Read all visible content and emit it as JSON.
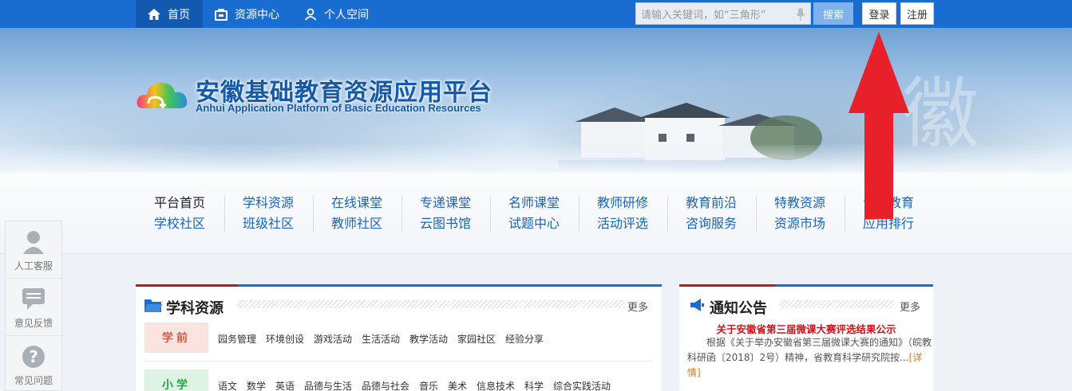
{
  "topnav": {
    "items": [
      {
        "label": "首页",
        "icon": "home-icon"
      },
      {
        "label": "资源中心",
        "icon": "resource-center-icon"
      },
      {
        "label": "个人空间",
        "icon": "user-icon"
      }
    ],
    "search_placeholder": "请输入关键词，如“三角形”",
    "search_label": "搜索",
    "login_label": "登录",
    "register_label": "注册"
  },
  "banner": {
    "title": "安徽基础教育资源应用平台",
    "subtitle": "Anhui Application Platform of Basic Education Resources",
    "calligraphy": "徽"
  },
  "catnav": {
    "columns": [
      [
        "平台首页",
        "学校社区"
      ],
      [
        "学科资源",
        "班级社区"
      ],
      [
        "在线课堂",
        "教师社区"
      ],
      [
        "专递课堂",
        "云图书馆"
      ],
      [
        "名师课堂",
        "试题中心"
      ],
      [
        "教师研修",
        "活动评选"
      ],
      [
        "教育前沿",
        "咨询服务"
      ],
      [
        "特教资源",
        "资源市场"
      ],
      [
        "专题教育",
        "应用排行"
      ]
    ]
  },
  "sidefloat": {
    "items": [
      {
        "label": "人工客服",
        "icon": "customer-service-icon"
      },
      {
        "label": "意见反馈",
        "icon": "feedback-icon"
      },
      {
        "label": "常见问题",
        "icon": "question-icon"
      }
    ]
  },
  "subject_panel": {
    "title": "学科资源",
    "more": "更多",
    "grades": [
      {
        "label": "学前",
        "subjects": [
          "园务管理",
          "环境创设",
          "游戏活动",
          "生活活动",
          "教学活动",
          "家园社区",
          "经验分享"
        ]
      },
      {
        "label": "小学",
        "subjects": [
          "语文",
          "数学",
          "英语",
          "品德与生活",
          "品德与社会",
          "音乐",
          "美术",
          "信息技术",
          "科学",
          "综合实践活动"
        ]
      }
    ]
  },
  "notice_panel": {
    "title": "通知公告",
    "more": "更多",
    "headline": "关于安徽省第三届微课大赛评选结果公示",
    "body": "根据《关于举办安徽省第三届微课大赛的通知》（皖教科研函〔2018〕2号）精神，省教育科学研究院按...",
    "detail_link": "[详情]"
  },
  "colors": {
    "topbar": "#1a6dd0",
    "title_blue": "#1559a8",
    "link_blue": "#1a64bd",
    "accent_red": "#c0171e",
    "annotation_arrow": "#e8202a"
  }
}
